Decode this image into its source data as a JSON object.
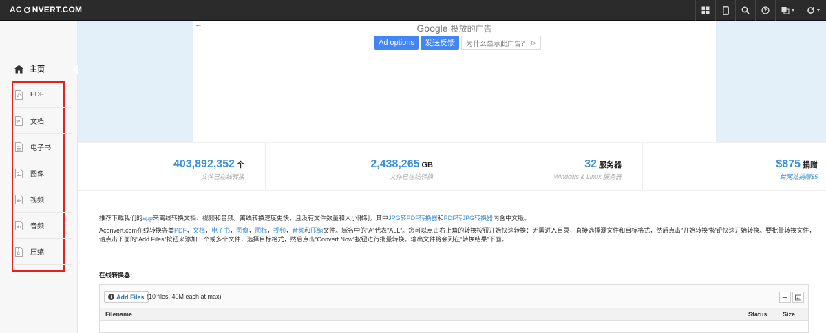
{
  "brand": {
    "pre": "AC",
    "post": "NVERT.COM"
  },
  "nav": {
    "icons": [
      "grid-icon",
      "mobile-icon",
      "search-icon",
      "help-icon",
      "language-icon",
      "refresh-icon"
    ]
  },
  "sidebar": {
    "home_label": "主页",
    "items": [
      {
        "label": "PDF",
        "icon": "pdf-icon"
      },
      {
        "label": "文档",
        "icon": "document-icon"
      },
      {
        "label": "电子书",
        "icon": "ebook-icon"
      },
      {
        "label": "图像",
        "icon": "image-icon"
      },
      {
        "label": "视频",
        "icon": "video-icon"
      },
      {
        "label": "音频",
        "icon": "audio-icon"
      },
      {
        "label": "压缩",
        "icon": "archive-icon"
      }
    ]
  },
  "ad": {
    "back": "←",
    "google": "Google",
    "tag": "投放的广告",
    "options": "Ad options",
    "feedback": "发送反馈",
    "why": "为什么显示此广告？",
    "why_icon": "▷"
  },
  "stats": [
    {
      "value": "403,892,352",
      "unit": "个",
      "sub": "文件已在线转换"
    },
    {
      "value": "2,438,265",
      "unit": "GB",
      "sub": "文件已在线转换"
    },
    {
      "value": "32",
      "unit": "服务器",
      "sub": "Windows & Linux 服务器"
    },
    {
      "value": "$875",
      "unit": "捐赠",
      "sub": "给网站捐赠$5"
    }
  ],
  "content": {
    "p1_a": "推荐下载我们的",
    "p1_link1": "app",
    "p1_b": "来离线转换文档、视频和音频。离线转换速度更快，且没有文件数量和大小限制。其中",
    "p1_link2": "JPG转PDF转换器",
    "p1_c": "和",
    "p1_link3": "PDF转JPG转换器",
    "p1_d": "内含中文版。",
    "p2_a": "Aconvert.com在线转换各类",
    "p2_l1": "PDF",
    "p2_s1": "，",
    "p2_l2": "文档",
    "p2_s2": "，",
    "p2_l3": "电子书",
    "p2_s3": "，",
    "p2_l4": "图像",
    "p2_s4": "，",
    "p2_l5": "图标",
    "p2_s5": "，",
    "p2_l6": "视频",
    "p2_s6": "，",
    "p2_l7": "音频",
    "p2_s7": "和",
    "p2_l8": "压缩",
    "p2_b": "文件。域名中的“A”代表“ALL”。您可以点击右上角的转换按钮开始快速转换：无需进入目录，直接选择源文件和目标格式，然后点击“开始转换”按钮快速开始转换。要批量转换文件，请点击下面的“Add Files”按钮来添加一个或多个文件，选择目标格式，然后点击“Convert Now”按钮进行批量转换。输出文件将会列在“转换结果”下面。"
  },
  "converter": {
    "title": "在线转换器:",
    "add_files": "Add Files",
    "hint": "(10 files, 40M each at max)",
    "col_filename": "Filename",
    "col_status": "Status",
    "col_size": "Size"
  },
  "colors": {
    "accent": "#3a8fd6",
    "navbar": "#2b2b2b",
    "highlight_box": "#e42020",
    "ad_bg": "#e3f0f9",
    "google_blue": "#4285f4"
  }
}
